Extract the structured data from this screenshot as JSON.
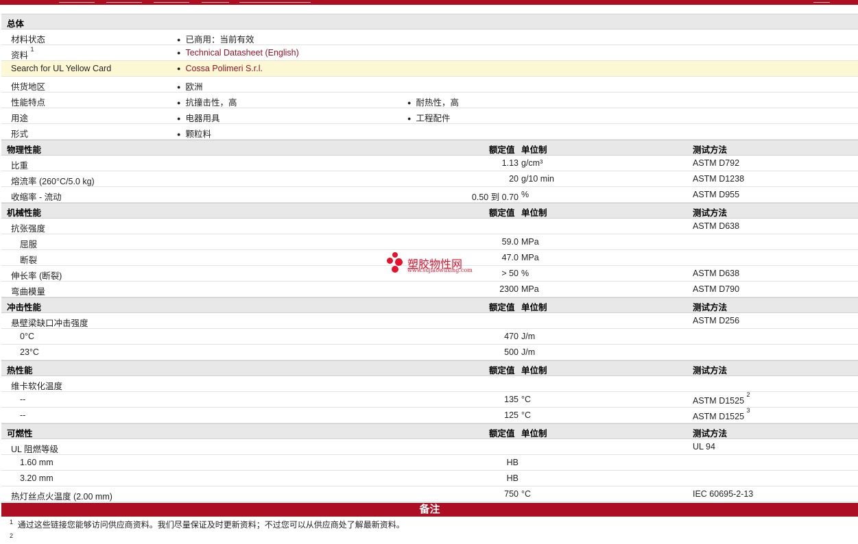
{
  "general": {
    "title": "总体",
    "rows": [
      {
        "label": "材料状态",
        "c1": "已商用：当前有效"
      },
      {
        "label": "资料",
        "sup": "1",
        "c1": "Technical Datasheet (English)"
      },
      {
        "label": "Search for UL Yellow Card",
        "c1": "Cossa Polimeri S.r.l."
      },
      {
        "label": "供货地区",
        "c1": "欧洲"
      },
      {
        "label": "性能特点",
        "c1": "抗撞击性，高",
        "c2": "耐热性，高"
      },
      {
        "label": "用途",
        "c1": "电器用具",
        "c2": "工程配件"
      },
      {
        "label": "形式",
        "c1": "颗粒料"
      }
    ]
  },
  "headers": {
    "value": "额定值",
    "unit": "单位制",
    "method": "测试方法"
  },
  "physical": {
    "title": "物理性能",
    "rows": [
      {
        "label": "比重",
        "value": "1.13",
        "unit": "g/cm³",
        "method": "ASTM D792"
      },
      {
        "label": "熔流率  (260°C/5.0 kg)",
        "value": "20",
        "unit": "g/10 min",
        "method": "ASTM D1238"
      },
      {
        "label": "收缩率  - 流动",
        "value": "0.50 到  0.70",
        "unit": "%",
        "method": "ASTM D955"
      }
    ]
  },
  "mechanical": {
    "title": "机械性能",
    "rows": [
      {
        "label": "抗张强度",
        "value": "",
        "unit": "",
        "method": "ASTM D638"
      },
      {
        "label": "屈服",
        "value": "59.0",
        "unit": "MPa",
        "method": ""
      },
      {
        "label": "断裂",
        "value": "47.0",
        "unit": "MPa",
        "method": ""
      },
      {
        "label": "伸长率  (断裂)",
        "value": "> 50",
        "unit": "%",
        "method": "ASTM D638"
      },
      {
        "label": "弯曲模量",
        "value": "2300",
        "unit": "MPa",
        "method": "ASTM D790"
      }
    ]
  },
  "impact": {
    "title": "冲击性能",
    "rows": [
      {
        "label": "悬壁梁缺口冲击强度",
        "value": "",
        "unit": "",
        "method": "ASTM D256"
      },
      {
        "label": "0°C",
        "value": "470",
        "unit": "J/m",
        "method": ""
      },
      {
        "label": "23°C",
        "value": "500",
        "unit": "J/m",
        "method": ""
      }
    ]
  },
  "thermal": {
    "title": "热性能",
    "rows": [
      {
        "label": "维卡软化温度",
        "value": "",
        "unit": "",
        "method": ""
      },
      {
        "label": "--",
        "value": "135",
        "unit": "°C",
        "method": "ASTM D1525",
        "sup": "2"
      },
      {
        "label": "--",
        "value": "125",
        "unit": "°C",
        "method": "ASTM D1525",
        "sup": "3"
      }
    ]
  },
  "flammability": {
    "title": "可燃性",
    "rows": [
      {
        "label": "UL 阻燃等级",
        "value": "",
        "unit": "",
        "method": "UL 94"
      },
      {
        "label": "1.60 mm",
        "value": "HB",
        "unit": "",
        "method": ""
      },
      {
        "label": "3.20 mm",
        "value": "HB",
        "unit": "",
        "method": ""
      },
      {
        "label": "热灯丝点火温度  (2.00 mm)",
        "value": "750",
        "unit": "°C",
        "method": "IEC 60695-2-13"
      }
    ]
  },
  "notes": {
    "title": "备注",
    "items": [
      {
        "num": "1",
        "text": "通过这些链接您能够访问供应商资料。我们尽量保证及时更新资料；不过您可以从供应商处了解最新资料。"
      },
      {
        "num": "2",
        "text": ""
      }
    ]
  },
  "watermark": {
    "title": "塑胶物性网",
    "url": "www.sujiaowuxing.com"
  },
  "colors": {
    "brand": "#ad0e21",
    "highlight": "#fdf8d4",
    "link": "#9d1126"
  }
}
